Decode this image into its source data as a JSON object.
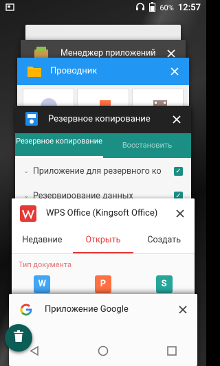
{
  "status_bar": {
    "battery_percent": "60%",
    "time": "12:57"
  },
  "recents": [
    {
      "title": ""
    },
    {
      "title": "Менеджер приложений"
    },
    {
      "title": "Проводник"
    },
    {
      "title": "Резервное копирование",
      "tabs": [
        "Резервное копирование",
        "Восстановить"
      ],
      "rows": [
        "Приложение для резервного ко",
        "Резервирование данных"
      ]
    },
    {
      "title": "WPS Office (Kingsoft Office)",
      "tabs": [
        "Недавние",
        "Открыть",
        "Создать"
      ],
      "section_label": "Тип документа",
      "doc_icons": [
        "W",
        "P",
        "S"
      ]
    },
    {
      "title": "Приложение Google"
    }
  ],
  "colors": {
    "explorer_header": "#2196f3",
    "backup_tabs": "#1b8f84",
    "wps_accent": "#e53935",
    "fab": "#0d5d57"
  }
}
